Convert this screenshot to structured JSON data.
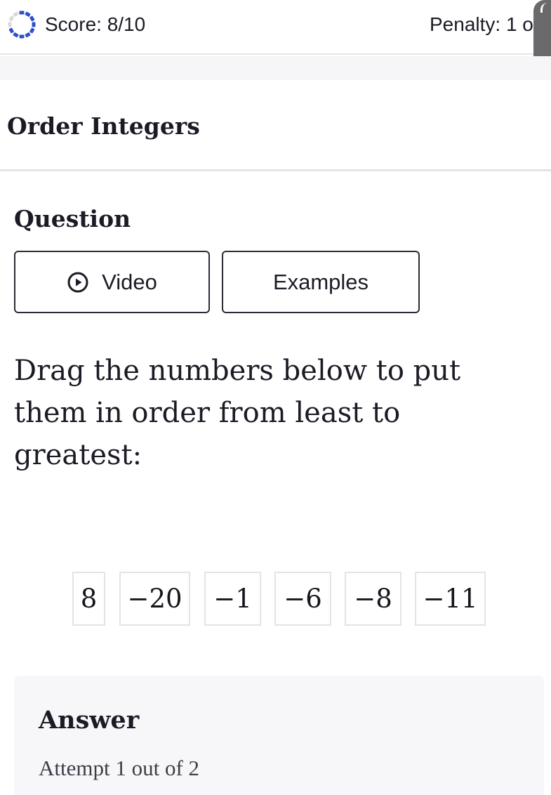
{
  "header": {
    "score_text": "Score: 8/10",
    "penalty_text": "Penalty: 1 o",
    "progress_icon": "dashed-progress-ring-icon",
    "ring_colors": {
      "filled": "#2f4fc9",
      "empty": "#d9d9de"
    }
  },
  "page": {
    "title": "Order Integers"
  },
  "question": {
    "title": "Question",
    "buttons": {
      "video_label": "Video",
      "video_icon": "play-circle-icon",
      "examples_label": "Examples"
    },
    "prompt": "Drag the numbers below to put them in order from least to greatest:",
    "tiles": [
      "8",
      "−20",
      "−1",
      "−6",
      "−8",
      "−11"
    ]
  },
  "answer": {
    "title": "Answer",
    "attempt_text": "Attempt 1 out of 2"
  }
}
